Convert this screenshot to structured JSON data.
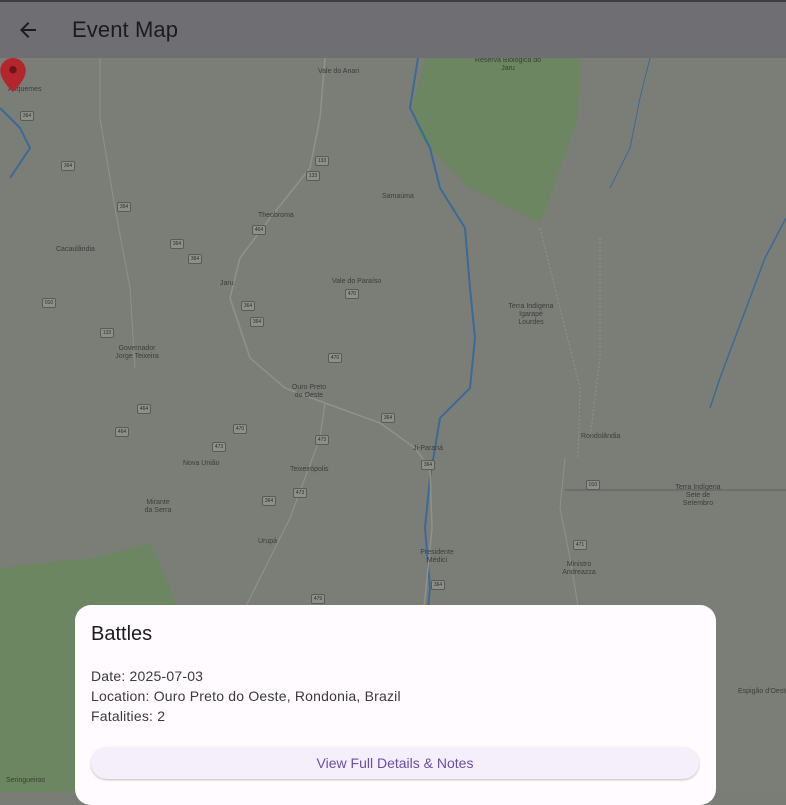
{
  "appbar": {
    "title": "Event Map",
    "back_icon": "arrow-back-icon"
  },
  "map": {
    "places": [
      "Vale do Anari",
      "Reserva Biológica do Jaru",
      "Ariquemes",
      "Theobroma",
      "Samaúma",
      "Cacaulândia",
      "Jaru",
      "Vale do Paraíso",
      "Terra Indígena Igarapé Lourdes",
      "Governador Jorge Teixeira",
      "Ouro Preto do Oeste",
      "Rondolândia",
      "Ji-Paraná",
      "Nova União",
      "Teixeirópolis",
      "Terra Indígena Sete de Setembro",
      "Mirante da Serra",
      "Urupá",
      "Presidente Médici",
      "Ministro Andreazza",
      "Espigão d'Oeste",
      "Seringueiras"
    ],
    "road_numbers": [
      "364",
      "364",
      "364",
      "133",
      "133",
      "464",
      "364",
      "364",
      "010",
      "364",
      "364",
      "470",
      "464",
      "464",
      "470",
      "473",
      "364",
      "364",
      "473",
      "470",
      "473",
      "364",
      "471",
      "479",
      "364",
      "133",
      "010"
    ]
  },
  "event": {
    "type": "Battles",
    "date": "Date: 2025-07-03",
    "location": "Location: Ouro Preto do Oeste, Rondonia, Brazil",
    "fatalities": "Fatalities: 2",
    "details_button": "View Full Details & Notes"
  },
  "colors": {
    "marker": "#b3262c",
    "accent": "#6750a4",
    "forest": "#6c8a60",
    "river": "#3a6a9a"
  }
}
